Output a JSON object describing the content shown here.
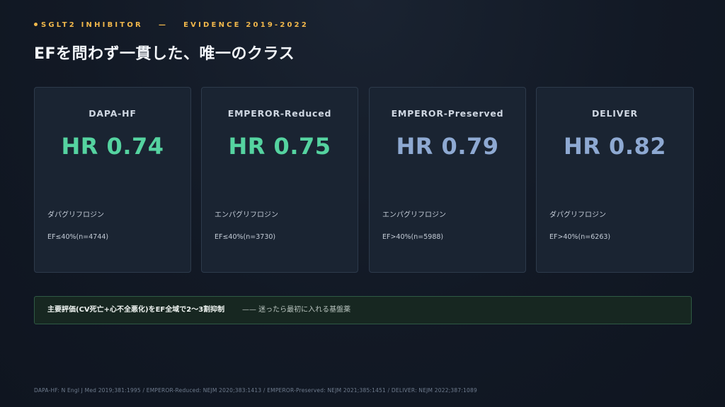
{
  "header": {
    "eyebrow_left": "SGLT2 INHIBITOR",
    "eyebrow_sep": "—",
    "eyebrow_right": "EVIDENCE 2019-2022",
    "title": "EFを問わず一貫した、唯一のクラス"
  },
  "cards": [
    {
      "name": "DAPA-HF",
      "hr": "HR 0.74",
      "drug": "ダパグリフロジン",
      "ef": "EF≤40%(n=4744)",
      "color": "#55d3a0"
    },
    {
      "name": "EMPEROR-Reduced",
      "hr": "HR 0.75",
      "drug": "エンパグリフロジン",
      "ef": "EF≤40%(n=3730)",
      "color": "#55d3a0"
    },
    {
      "name": "EMPEROR-Preserved",
      "hr": "HR 0.79",
      "drug": "エンパグリフロジン",
      "ef": "EF>40%(n=5988)",
      "color": "#8ea9d2"
    },
    {
      "name": "DELIVER",
      "hr": "HR 0.82",
      "drug": "ダパグリフロジン",
      "ef": "EF>40%(n=6263)",
      "color": "#8ea9d2"
    }
  ],
  "banner": {
    "strong": "主要評価(CV死亡+心不全悪化)をEF全域で2〜3割抑制",
    "rest": "—— 迷ったら最初に入れる基盤薬"
  },
  "footer": {
    "citation": "DAPA-HF: N Engl J Med 2019;381:1995 / EMPEROR-Reduced: NEJM 2020;383:1413 / EMPEROR-Preserved: NEJM 2021;385:1451 / DELIVER: NEJM 2022;387:1089"
  },
  "colors": {
    "accent": "#f2b84b",
    "green": "#55d3a0",
    "blue": "#8ea9d2"
  }
}
